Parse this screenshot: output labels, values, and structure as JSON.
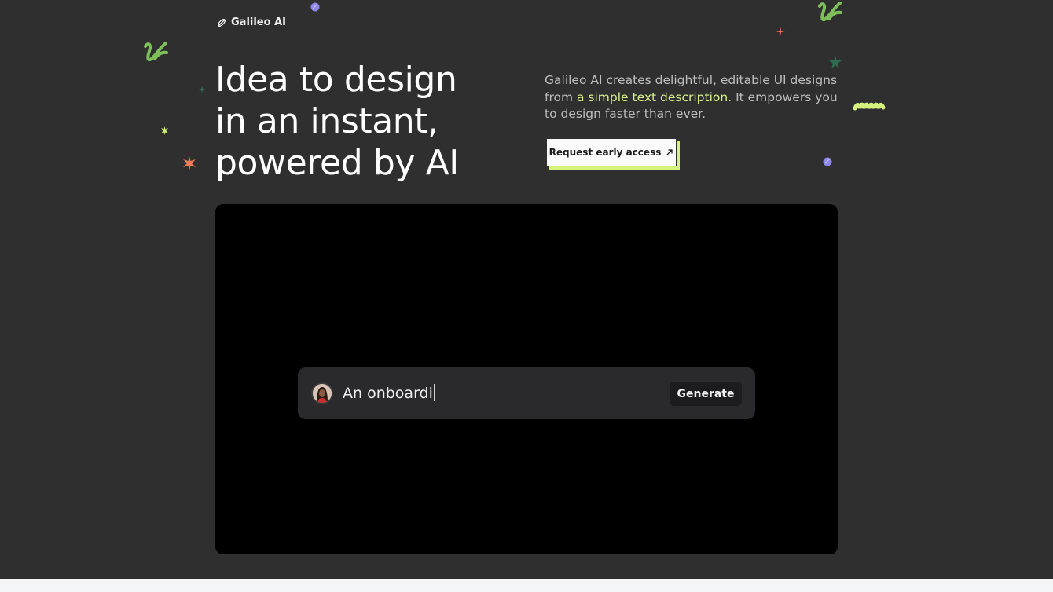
{
  "brand": {
    "name": "Galileo AI"
  },
  "hero": {
    "headline_line1": "Idea to design",
    "headline_line2": "in an instant,",
    "headline_line3": "powered by AI",
    "description_pre": "Galileo AI creates delightful, editable UI designs from ",
    "description_highlight": "a simple text description",
    "description_post": ". It empowers you to design faster than ever.",
    "cta_label": "Request early access"
  },
  "demo": {
    "prompt_text": "An onboardi",
    "generate_label": "Generate"
  },
  "colors": {
    "background": "#2f2f2f",
    "accent_lime": "#d6f27e",
    "accent_green": "#7fbf5a",
    "accent_coral": "#f07a5a",
    "accent_purple": "#8d86e6"
  },
  "icons": [
    "logo-icon",
    "arrow-up-right-icon",
    "avatar"
  ]
}
